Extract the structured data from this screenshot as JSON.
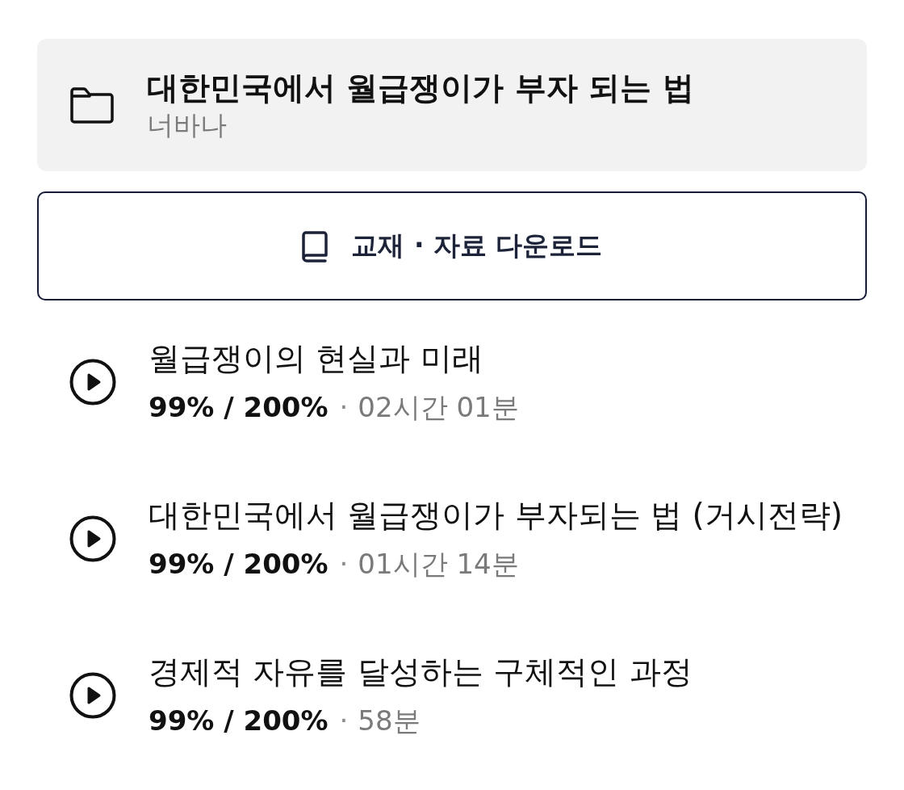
{
  "course": {
    "title": "대한민국에서 월급쟁이가 부자 되는 법",
    "instructor": "너바나"
  },
  "download_button": {
    "label": "교재 · 자료 다운로드"
  },
  "lessons": [
    {
      "title": "월급쟁이의 현실과 미래",
      "progress": "99% / 200%",
      "separator": "·",
      "duration": "02시간 01분"
    },
    {
      "title": "대한민국에서 월급쟁이가 부자되는 법 (거시전략)",
      "progress": "99% / 200%",
      "separator": "·",
      "duration": "01시간 14분"
    },
    {
      "title": "경제적 자유를 달성하는 구체적인 과정",
      "progress": "99% / 200%",
      "separator": "·",
      "duration": "58분"
    }
  ]
}
